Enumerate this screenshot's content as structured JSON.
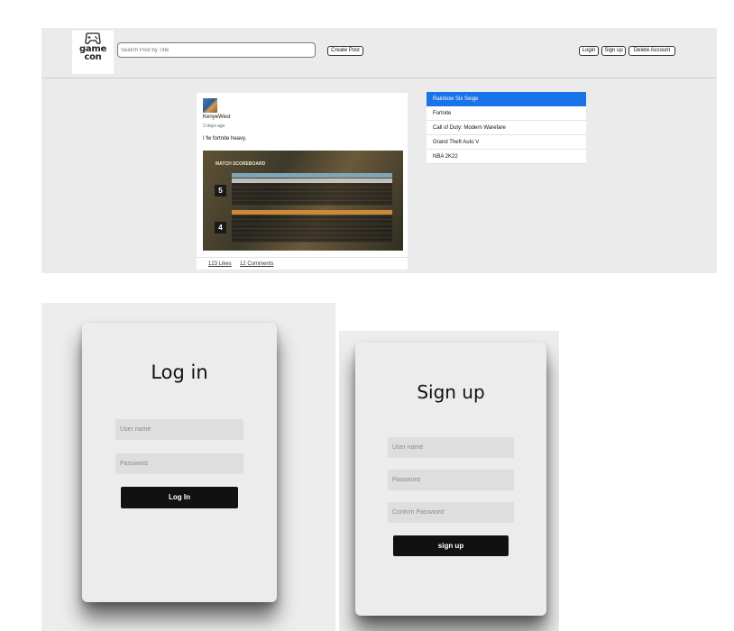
{
  "header": {
    "logo_text_line1": "game",
    "logo_text_line2": "con",
    "search_placeholder": "Search Post by Title",
    "create_post_label": "Create Post",
    "login_label": "Login",
    "signup_label": "Sign up",
    "delete_account_label": "Delete Account"
  },
  "post": {
    "author": "KenyeWest",
    "time": "3 days ago",
    "content": "I fw fortnite heavy.",
    "image_title": "MATCH SCOREBOARD",
    "team1_score": "5",
    "team2_score": "4",
    "likes": "123 Likes",
    "comments": "12 Comments"
  },
  "games": {
    "items": [
      {
        "label": "Rainbow Six Seige",
        "active": true
      },
      {
        "label": "Fortnite",
        "active": false
      },
      {
        "label": "Call of Duty: Modern Warefare",
        "active": false
      },
      {
        "label": "Grand Theft Auto V",
        "active": false
      },
      {
        "label": "NBA 2K22",
        "active": false
      }
    ]
  },
  "login": {
    "title": "Log in",
    "username_placeholder": "User name",
    "password_placeholder": "Password",
    "submit_label": "Log In"
  },
  "signup": {
    "title": "Sign up",
    "username_placeholder": "User name",
    "password_placeholder": "Password",
    "confirm_placeholder": "Confirm Password",
    "submit_label": "sign up"
  },
  "colors": {
    "accent": "#1a73e8",
    "button_dark": "#111111"
  }
}
